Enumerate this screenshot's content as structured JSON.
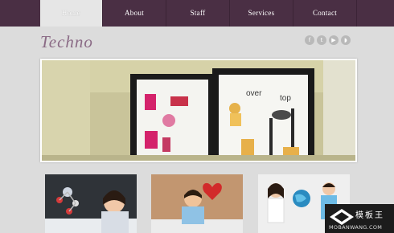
{
  "nav": {
    "items": [
      {
        "label": "Home",
        "active": true
      },
      {
        "label": "About"
      },
      {
        "label": "Staff"
      },
      {
        "label": "Services"
      },
      {
        "label": "Contact"
      }
    ]
  },
  "logo": {
    "text": "Techno"
  },
  "social": [
    {
      "icon": "facebook-icon",
      "glyph": "f"
    },
    {
      "icon": "twitter-icon",
      "glyph": "t"
    },
    {
      "icon": "youtube-icon",
      "glyph": "▶"
    },
    {
      "icon": "rss-icon",
      "glyph": "◗"
    }
  ],
  "hero": {
    "frame_left_text": "",
    "frame_right_text_1": "over",
    "frame_right_text_2": "top"
  },
  "watermark": {
    "title": "模板王",
    "sub": "MOBANWANG.COM"
  },
  "colors": {
    "topbar": "#4a2f44",
    "background": "#dcdcdc",
    "logo": "#8a6a85"
  }
}
